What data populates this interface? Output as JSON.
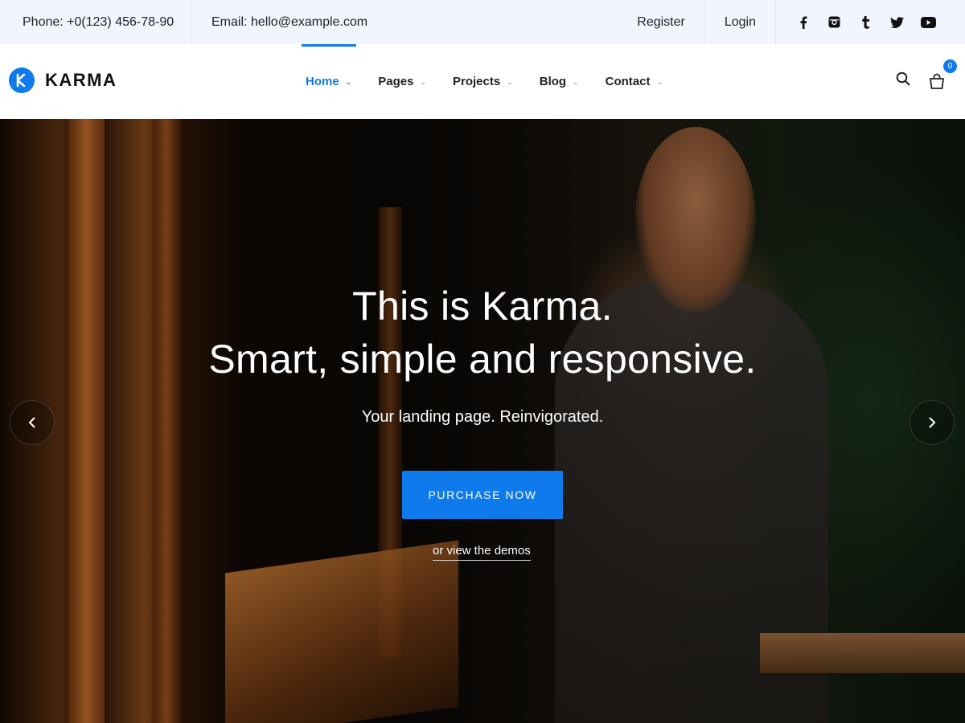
{
  "topbar": {
    "phone": "Phone: +0(123) 456-78-90",
    "email": "Email: hello@example.com",
    "register": "Register",
    "login": "Login",
    "social_icons": [
      "facebook-icon",
      "instagram-icon",
      "tumblr-icon",
      "twitter-icon",
      "youtube-icon"
    ]
  },
  "header": {
    "logo_text": "KARMA",
    "nav": [
      {
        "label": "Home",
        "active": true
      },
      {
        "label": "Pages",
        "active": false
      },
      {
        "label": "Projects",
        "active": false
      },
      {
        "label": "Blog",
        "active": false
      },
      {
        "label": "Contact",
        "active": false
      }
    ],
    "cart_count": "0"
  },
  "hero": {
    "title_line1": "This is Karma.",
    "title_line2": "Smart, simple and responsive.",
    "subtitle": "Your landing page. Reinvigorated.",
    "cta": "PURCHASE NOW",
    "secondary_link": "or view the demos"
  },
  "colors": {
    "accent": "#0f7aeb",
    "topbar_bg": "#f1f5fd"
  }
}
